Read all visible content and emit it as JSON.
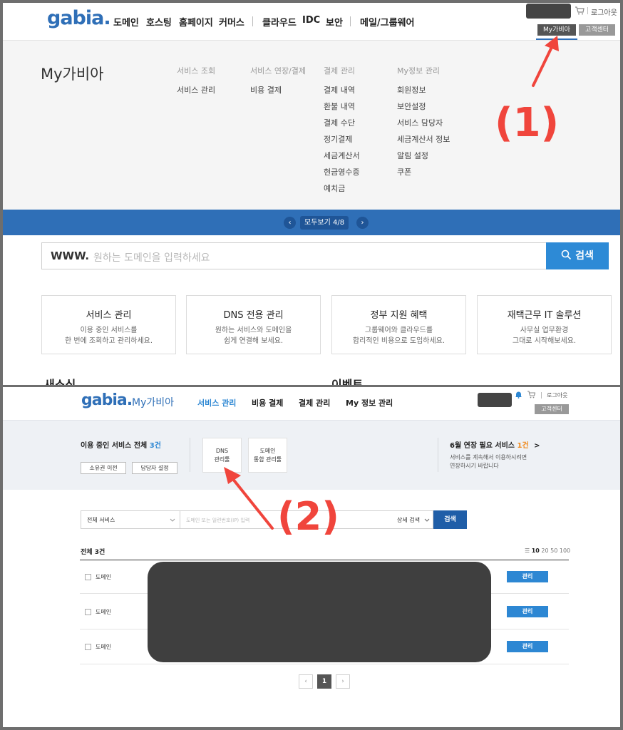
{
  "panel1": {
    "logo": "gabia.",
    "nav": [
      "도메인",
      "호스팅",
      "홈페이지",
      "커머스",
      "클라우드",
      "IDC",
      "보안",
      "메일/그룹웨어"
    ],
    "logout": "로그아웃",
    "mygabia_btn": "My가비아",
    "support_btn": "고객센터",
    "mega_title": "My가비아",
    "columns": [
      {
        "header": "서비스 조회",
        "items": [
          "서비스 관리"
        ]
      },
      {
        "header": "서비스 연장/결제",
        "items": [
          "비용 결제"
        ]
      },
      {
        "header": "결제 관리",
        "items": [
          "결제 내역",
          "환불 내역",
          "결제 수단",
          "정기결제",
          "세금계산서",
          "현금영수증",
          "예치금"
        ]
      },
      {
        "header": "My정보 관리",
        "items": [
          "회원정보",
          "보안설정",
          "서비스 담당자",
          "세금계산서 정보",
          "알림 설정",
          "쿠폰"
        ]
      }
    ],
    "pager": {
      "prev": "‹",
      "next": "›",
      "label": "모두보기  4/8"
    },
    "search": {
      "prefix": "WWW.",
      "placeholder": "원하는 도메인을 입력하세요",
      "button": "검색"
    },
    "cards": [
      {
        "title": "서비스 관리",
        "line1": "이용 중인 서비스를",
        "line2": "한 번에 조회하고 관리하세요."
      },
      {
        "title": "DNS 전용 관리",
        "line1": "원하는 서비스와 도메인을",
        "line2": "쉽게 연결해 보세요."
      },
      {
        "title": "정부 지원 혜택",
        "line1": "그룹웨어와 클라우드를",
        "line2": "합리적인 비용으로 도입하세요."
      },
      {
        "title": "재택근무 IT 솔루션",
        "line1": "사무실 업무환경",
        "line2": "그대로 시작해보세요."
      }
    ],
    "cut_left": "새소식",
    "cut_right": "이벤트",
    "annotation": "(1)"
  },
  "panel2": {
    "logo": "gabia.",
    "logo_sub": "My가비아",
    "nav": [
      "서비스 관리",
      "비용 결제",
      "결제 관리",
      "My 정보 관리"
    ],
    "logout": "로그아웃",
    "support_btn": "고객센터",
    "summary": {
      "title_prefix": "이용 중인 서비스 전체 ",
      "count": "3건",
      "transfer_btn": "소유권 이전",
      "manager_btn": "담당자 설정",
      "tile1_line1": "DNS",
      "tile1_line2": "관리툴",
      "tile2_line1": "도메인",
      "tile2_line2": "통합 관리툴",
      "renew_prefix": "6월 연장 필요 서비스 ",
      "renew_count": "1건",
      "renew_arrow": ">",
      "renew_desc1": "서비스를 계속해서 이용하시려면",
      "renew_desc2": "연장하시기 바랍니다"
    },
    "filter": {
      "select": "전체 서비스",
      "placeholder": "도메인 또는 일련번호(IP) 입력",
      "detail": "상세 검색",
      "button": "검색"
    },
    "total": "전체 3건",
    "page_sizes": [
      "10",
      "20",
      "50",
      "100"
    ],
    "rows": [
      {
        "type": "도메인",
        "action": "관리"
      },
      {
        "type": "도메인",
        "action": "관리"
      },
      {
        "type": "도메인",
        "action": "관리"
      }
    ],
    "pagination": {
      "prev": "‹",
      "current": "1",
      "next": "›"
    },
    "annotation": "(2)"
  },
  "colors": {
    "brand_blue": "#2f6fb7",
    "search_blue": "#2d8ad6",
    "annotation_red": "#f0453c",
    "mask": "#444444"
  }
}
